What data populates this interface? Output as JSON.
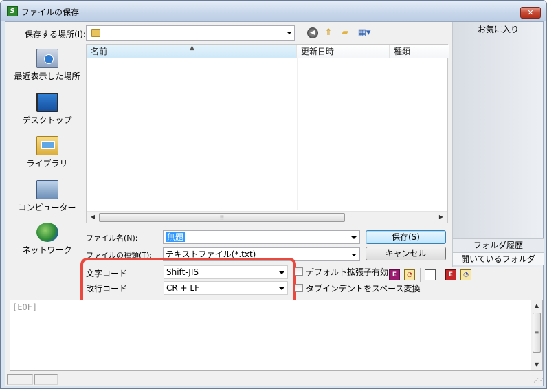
{
  "window": {
    "title": "ファイルの保存",
    "app_icon_label": "S",
    "close_label": "✕"
  },
  "location": {
    "label": "保存する場所(I):",
    "value": "",
    "toolbar_icons": [
      "back-icon",
      "up-folder-icon",
      "new-folder-icon",
      "views-menu-icon"
    ]
  },
  "places": [
    {
      "label": "最近表示した場所",
      "icon": "recent-places-icon"
    },
    {
      "label": "デスクトップ",
      "icon": "desktop-icon"
    },
    {
      "label": "ライブラリ",
      "icon": "library-icon"
    },
    {
      "label": "コンピューター",
      "icon": "computer-icon"
    },
    {
      "label": "ネットワーク",
      "icon": "network-icon"
    }
  ],
  "file_list": {
    "columns": [
      "名前",
      "更新日時",
      "種類"
    ],
    "sorted_column": "名前",
    "rows": []
  },
  "right_panel": {
    "title": "お気に入り",
    "tabs": [
      "フォルダ履歴",
      "開いているフォルダ"
    ]
  },
  "filename": {
    "label": "ファイル名(N):",
    "value": "無題"
  },
  "filetype": {
    "label": "ファイルの種類(T):",
    "value": "テキストファイル(*.txt)"
  },
  "buttons": {
    "save": "保存(S)",
    "cancel": "キャンセル"
  },
  "encoding": {
    "label": "文字コード",
    "value": "Shift-JIS"
  },
  "line_ending": {
    "label": "改行コード",
    "value": "CR + LF"
  },
  "options": {
    "default_ext": "デフォルト拡張子有効",
    "tab_indent": "タブインデントをスペース変換"
  },
  "editor": {
    "content": "[EOF]"
  },
  "colors": {
    "highlight": "#e8483e",
    "eof_line": "#7c1f86",
    "selection": "#3399ff"
  }
}
